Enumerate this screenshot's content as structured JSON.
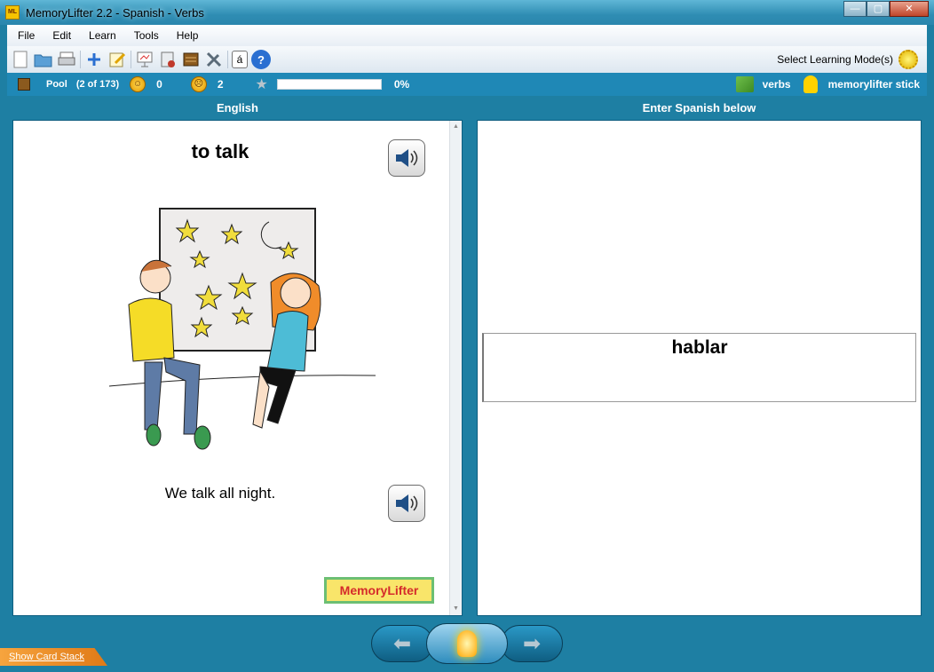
{
  "window": {
    "title": "MemoryLifter 2.2 - Spanish - Verbs",
    "app_icon_text": "ML",
    "buttons": {
      "minimize": "—",
      "maximize": "▢",
      "close": "✕"
    }
  },
  "menu": [
    "File",
    "Edit",
    "Learn",
    "Tools",
    "Help"
  ],
  "toolbar": {
    "icons": [
      "new-document-icon",
      "open-folder-icon",
      "print-icon",
      "add-icon",
      "edit-icon",
      "presentation-icon",
      "card-manager-icon",
      "box-icon",
      "tools-icon",
      "special-character-icon",
      "help-icon"
    ],
    "special_char_glyph": "á",
    "help_glyph": "?",
    "mode_label": "Select Learning Mode(s)"
  },
  "status": {
    "pool_label": "Pool",
    "pool_count": "(2 of 173)",
    "correct_count": "0",
    "wrong_count": "2",
    "progress_percent": 0,
    "progress_text": "0%",
    "dictionary_name": "verbs",
    "user_name": "memorylifter stick"
  },
  "question_panel": {
    "title": "English",
    "word": "to talk",
    "example": "We talk all night.",
    "logo_text": "MemoryLifter"
  },
  "answer_panel": {
    "title": "Enter Spanish below",
    "answer": "hablar"
  },
  "nav": {
    "prev_glyph": "⬅",
    "next_glyph": "➡"
  },
  "footer": {
    "show_stack_label": "Show Card Stack"
  }
}
